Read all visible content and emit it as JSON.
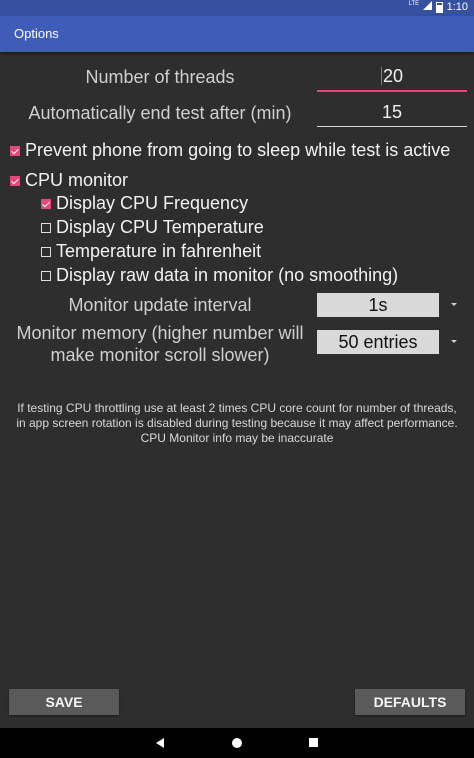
{
  "status_bar": {
    "network": "LTE",
    "time": "1:10"
  },
  "app_bar": {
    "title": "Options"
  },
  "threads": {
    "label": "Number of threads",
    "value": "20"
  },
  "auto_end": {
    "label": "Automatically end test after (min)",
    "value": "15"
  },
  "prevent_sleep": {
    "label": "Prevent phone from going to sleep while test is active",
    "checked": true
  },
  "cpu_monitor": {
    "label": "CPU monitor",
    "checked": true
  },
  "monitor_options": [
    {
      "label": "Display CPU Frequency",
      "checked": true
    },
    {
      "label": "Display CPU Temperature",
      "checked": false
    },
    {
      "label": "Temperature in fahrenheit",
      "checked": false
    },
    {
      "label": "Display raw data in monitor (no smoothing)",
      "checked": false
    }
  ],
  "update_interval": {
    "label": "Monitor update interval",
    "value": "1s"
  },
  "memory": {
    "label_line1": "Monitor memory (higher number will",
    "label_line2": "make monitor scroll slower)",
    "value": "50 entries"
  },
  "info": {
    "line1": "If testing CPU throttling use at least 2 times CPU core count for number of threads,",
    "line2": "in app screen rotation is disabled during testing because it may affect performance.",
    "line3": "CPU Monitor info may be inaccurate"
  },
  "buttons": {
    "save": "SAVE",
    "defaults": "DEFAULTS"
  },
  "colors": {
    "accent": "#e8447e",
    "app_bar": "#3f5db8",
    "status_bar": "#3551a0",
    "background": "#2e2e2e"
  },
  "icons": [
    "lte-signal-icon",
    "battery-icon",
    "back-icon",
    "home-icon",
    "recents-icon",
    "dropdown-arrow-icon"
  ]
}
